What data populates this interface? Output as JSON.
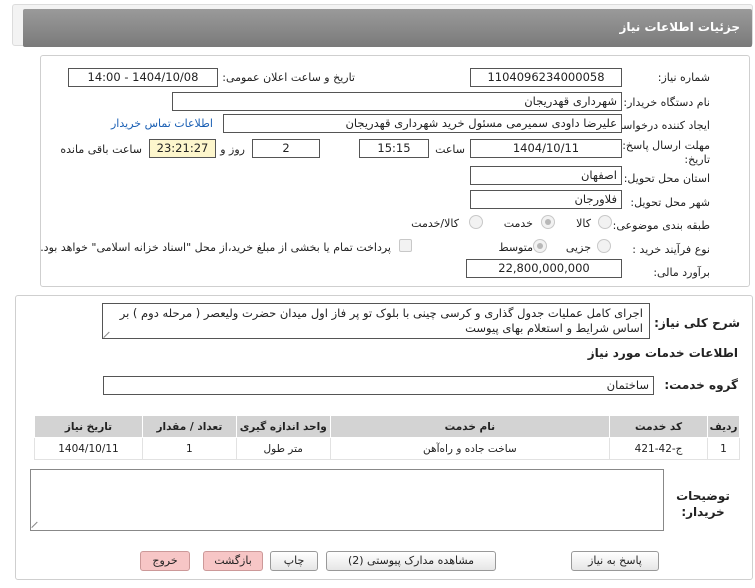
{
  "header": {
    "title": "جزئیات اطلاعات نیاز"
  },
  "form": {
    "need_number": {
      "label": "شماره نیاز:",
      "value": "1104096234000058"
    },
    "announce": {
      "label": "تاریخ و ساعت اعلان عمومی:",
      "value": "1404/10/08 - 14:00"
    },
    "buyer_org": {
      "label": "نام دستگاه خریدار:",
      "value": "شهرداری قهدریجان"
    },
    "creator": {
      "label": "ایجاد کننده درخواست:",
      "value": "علیرضا داودی سمیرمی مسئول خرید  شهرداری قهدریجان"
    },
    "contact_link": "اطلاعات تماس خریدار",
    "deadline": {
      "label_line1": "مهلت ارسال پاسخ: تا",
      "label_line2": "تاریخ:",
      "date": "1404/10/11",
      "time_label": "ساعت",
      "time": "15:15",
      "days": "2",
      "days_label": "روز و",
      "remaining": "23:21:27",
      "remaining_label": "ساعت باقی مانده"
    },
    "province": {
      "label": "استان محل تحویل:",
      "value": "اصفهان"
    },
    "city": {
      "label": "شهر محل تحویل:",
      "value": "فلاورجان"
    },
    "category": {
      "label": "طبقه بندی موضوعی:",
      "options": [
        "کالا",
        "خدمت",
        "کالا/خدمت"
      ],
      "selected": "خدمت"
    },
    "purchase_type": {
      "label": "نوع فرآیند خرید :",
      "options": [
        "جزیی",
        "متوسط"
      ],
      "selected": "متوسط",
      "payment_note": "پرداخت تمام یا بخشی از مبلغ خرید،از محل \"اسناد خزانه اسلامی\" خواهد بود."
    },
    "budget": {
      "label": "برآورد مالی:",
      "value": "22,800,000,000"
    }
  },
  "details": {
    "summary_label": "شرح کلی نیاز:",
    "summary_text": "اجرای کامل عملیات جدول گذاری و کرسی چینی با بلوک تو پر فاز اول میدان حضرت ولیعصر ( مرحله دوم )  بر اساس شرایط و استعلام بهای پیوست",
    "services_title": "اطلاعات خدمات مورد نیاز",
    "service_group_label": "گروه خدمت:",
    "service_group_value": "ساختمان",
    "table": {
      "headers": [
        "ردیف",
        "کد خدمت",
        "نام خدمت",
        "واحد اندازه گیری",
        "تعداد / مقدار",
        "تاریخ نیاز"
      ],
      "rows": [
        [
          "1",
          "ج-42-421",
          "ساخت جاده و راه‌آهن",
          "متر طول",
          "1",
          "1404/10/11"
        ]
      ]
    },
    "buyer_notes_label": "توضیحات خریدار:"
  },
  "buttons": {
    "reply": "پاسخ به نیاز",
    "view_docs": "مشاهده مدارک پیوستی (2)",
    "print": "چاپ",
    "back": "بازگشت",
    "exit": "خروج"
  }
}
